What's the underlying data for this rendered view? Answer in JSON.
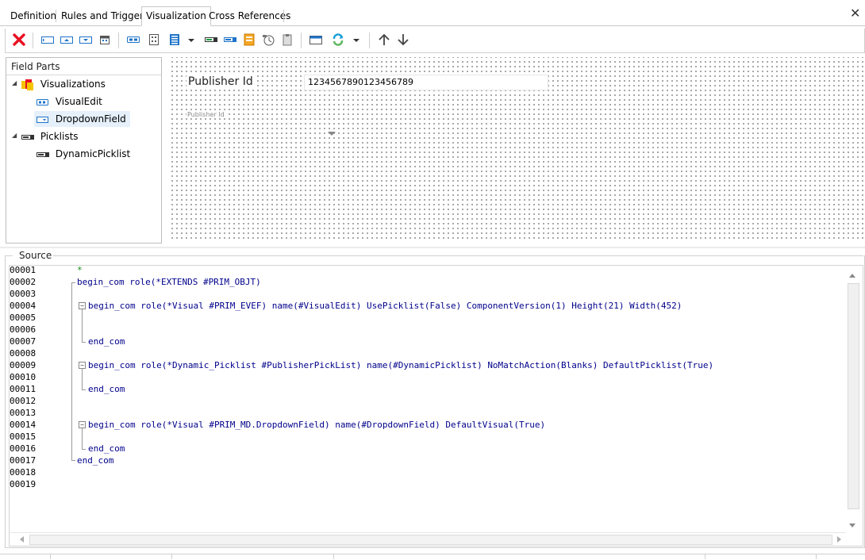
{
  "tabs": [
    {
      "label": "Definition"
    },
    {
      "label": "Rules and Triggers"
    },
    {
      "label": "Visualization",
      "selected": true
    },
    {
      "label": "Cross References"
    }
  ],
  "close_icon": "close-icon",
  "toolbar": {
    "icons": [
      "delete-icon",
      "field-left-label-icon",
      "field-top-label-icon",
      "field-right-label-icon",
      "calendar-field-icon",
      "visual-edit-icon",
      "spin-edit-icon",
      "list-icon",
      "dropdown-arrow-icon",
      "picklist-icon",
      "dynamic-picklist-icon",
      "image-icon",
      "timer-icon",
      "clipboard-icon",
      "panel-icon",
      "refresh-icon",
      "dropdown-arrow-icon",
      "move-up-icon",
      "move-down-icon"
    ],
    "accent_red": "#e81123",
    "accent_blue": "#1e73c8"
  },
  "field_parts": {
    "title": "Field Parts",
    "tree": {
      "visualizations": {
        "label": "Visualizations",
        "items": [
          {
            "label": "VisualEdit"
          },
          {
            "label": "DropdownField",
            "selected": true
          }
        ]
      },
      "picklists": {
        "label": "Picklists",
        "items": [
          {
            "label": "DynamicPicklist"
          }
        ]
      }
    }
  },
  "designer": {
    "publisher_label": "Publisher Id",
    "publisher_value": "1234567890123456789",
    "dropdown_label": "Publisher Id"
  },
  "source": {
    "title": "Source",
    "line_numbers": [
      "00001",
      "00002",
      "00003",
      "00004",
      "00005",
      "00006",
      "00007",
      "00008",
      "00009",
      "00010",
      "00011",
      "00012",
      "00013",
      "00014",
      "00015",
      "00016",
      "00017",
      "00018",
      "00019"
    ],
    "lines": [
      "*",
      "begin_com role(*EXTENDS #PRIM_OBJT)",
      "",
      "begin_com role(*Visual #PRIM_EVEF) name(#VisualEdit) UsePicklist(False) ComponentVersion(1) Height(21) Width(452)",
      "",
      "",
      "end_com",
      "",
      "begin_com role(*Dynamic_Picklist #PublisherPickList) name(#DynamicPicklist) NoMatchAction(Blanks) DefaultPicklist(True)",
      "",
      "end_com",
      "",
      "",
      "begin_com role(*Visual #PRIM_MD.DropdownField) name(#DropdownField) DefaultVisual(True)",
      "",
      "end_com",
      "end_com",
      "",
      ""
    ]
  }
}
